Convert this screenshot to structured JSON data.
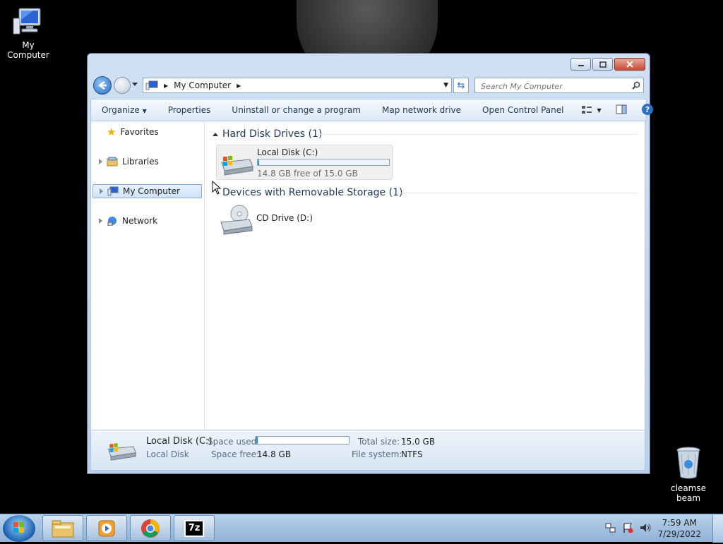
{
  "desktop": {
    "icons": [
      {
        "label": "My Computer",
        "icon": "computer-icon"
      },
      {
        "label": "cleanse beam",
        "line1": "cleamse",
        "line2": "beam",
        "icon": "recycle-bin-icon"
      }
    ]
  },
  "window": {
    "caption_buttons": {
      "minimize": "minimize-icon",
      "maximize": "maximize-icon",
      "close": "close-icon"
    },
    "address": {
      "crumb": "My Computer"
    },
    "search": {
      "placeholder": "Search My Computer"
    },
    "toolbar": {
      "organize": "Organize",
      "properties": "Properties",
      "uninstall": "Uninstall or change a program",
      "map_drive": "Map network drive",
      "control_panel": "Open Control Panel"
    },
    "nav": {
      "favorites": "Favorites",
      "libraries": "Libraries",
      "my_computer": "My Computer",
      "network": "Network"
    },
    "groups": {
      "hdd": {
        "title": "Hard Disk Drives (1)"
      },
      "removable": {
        "title": "Devices with Removable Storage (1)"
      }
    },
    "drives": {
      "c": {
        "name": "Local Disk (C:)",
        "free_text": "14.8 GB free of 15.0 GB",
        "used_fraction": 0.013
      },
      "d": {
        "name": "CD Drive (D:)"
      }
    },
    "details": {
      "name": "Local Disk (C:)",
      "type": "Local Disk",
      "space_used_label": "Space used:",
      "space_free_label": "Space free:",
      "space_free": "14.8 GB",
      "total_size_label": "Total size:",
      "total_size": "15.0 GB",
      "fs_label": "File system:",
      "fs": "NTFS"
    }
  },
  "taskbar": {
    "apps": [
      "windows-explorer-icon",
      "media-player-icon",
      "chrome-icon",
      "7zip-icon"
    ],
    "sevenzip_label": "7z",
    "time": "7:59 AM",
    "date": "7/29/2022"
  },
  "colors": {
    "accent": "#2a6fc2",
    "selection": "#cfe3fb",
    "taskbar": "#a9c5e4"
  }
}
